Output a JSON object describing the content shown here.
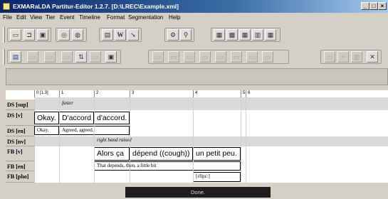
{
  "window": {
    "title": "EXMARaLDA Partitur-Editor 1.2.7. [D:\\LREC\\Example.xml]",
    "buttons": [
      "_",
      "□",
      "×"
    ]
  },
  "menu": [
    "File",
    "Edit",
    "View",
    "Tier",
    "Event",
    "Timeline",
    "Format",
    "Segmentation",
    "Help"
  ],
  "timeline": [
    "0 [1.3]",
    "1",
    "2",
    "3",
    "4",
    "5",
    "6"
  ],
  "tiers": [
    {
      "label": "DS [sup]"
    },
    {
      "label": "DS [v]"
    },
    {
      "label": "DS [en]"
    },
    {
      "label": "DS [nv]"
    },
    {
      "label": "FB [v]"
    },
    {
      "label": "FB [en]"
    },
    {
      "label": "FB [pho]"
    }
  ],
  "events": {
    "ds_sup_1": "faster",
    "ds_v_0": "Okay.",
    "ds_v_1": "D'accord",
    "ds_v_2": "d'accord.",
    "ds_en_0": "Okay.",
    "ds_en_1": "Agreed, agreed.",
    "ds_nv_2": "right hand raised",
    "fb_v_2": "Alors ça",
    "fb_v_3": "dépend ((cough))",
    "fb_v_4": "un petit peu.",
    "fb_en_2": "That depends, then, a little bit",
    "fb_pho_4": "[ɛ̃tipɛ:]"
  },
  "status": "Done."
}
